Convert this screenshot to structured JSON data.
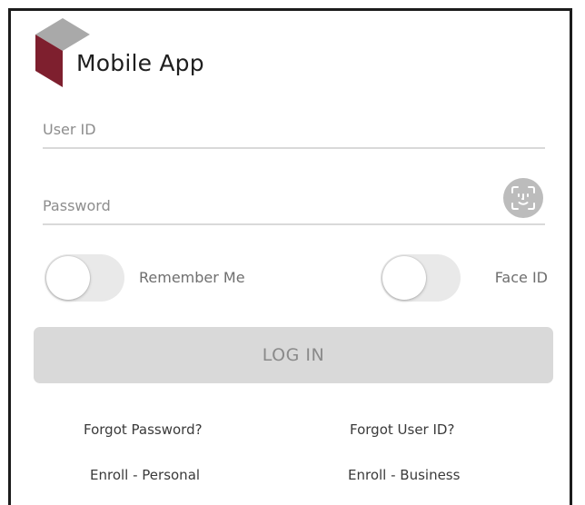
{
  "app": {
    "title": "Mobile App",
    "logo_icon": "cube-logo-icon",
    "logo_colors": {
      "top": "#a9a9a9",
      "side": "#7e1f2e"
    }
  },
  "login_form": {
    "user_id": {
      "value": "",
      "placeholder": "User ID"
    },
    "password": {
      "value": "",
      "placeholder": "Password"
    },
    "face_id_button_icon": "face-scan-icon",
    "remember_me": {
      "label": "Remember Me",
      "checked": false
    },
    "face_id": {
      "label": "Face ID",
      "checked": false
    },
    "login_button_label": "LOG IN"
  },
  "links": {
    "forgot_password": "Forgot Password?",
    "forgot_user_id": "Forgot User ID?",
    "enroll_personal": "Enroll - Personal",
    "enroll_business": "Enroll - Business"
  },
  "colors": {
    "frame_border": "#1c1c1c",
    "button_disabled_bg": "#d9d9d9",
    "toggle_off_bg": "#e9e9e9"
  }
}
